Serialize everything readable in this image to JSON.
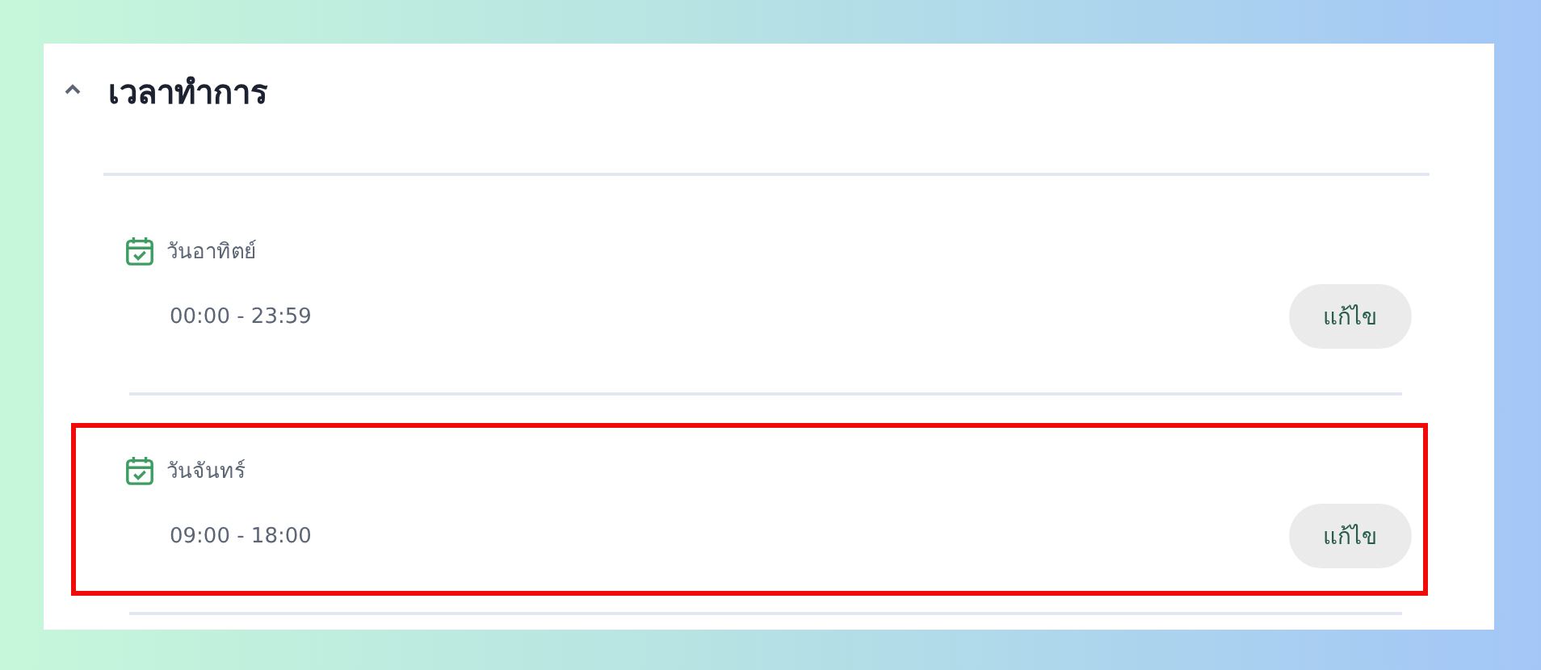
{
  "section": {
    "title": "เวลาทำการ",
    "expanded": true
  },
  "days": [
    {
      "label": "วันอาทิตย์",
      "hours": "00:00 - 23:59",
      "button": "แก้ไข",
      "highlighted": false
    },
    {
      "label": "วันจันทร์",
      "hours": "09:00 - 18:00",
      "button": "แก้ไข",
      "highlighted": true
    }
  ]
}
